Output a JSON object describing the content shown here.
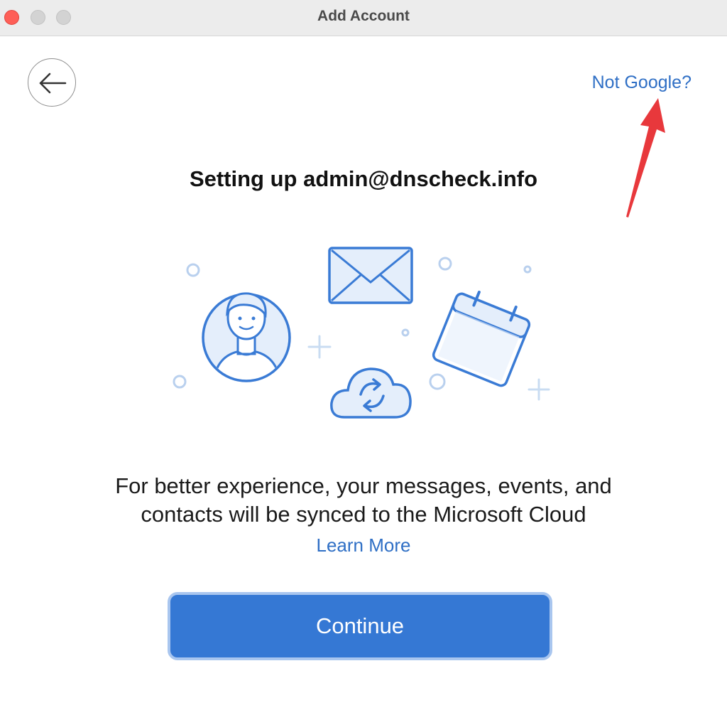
{
  "window": {
    "title": "Add Account",
    "controls": [
      "close",
      "minimize",
      "zoom"
    ]
  },
  "nav": {
    "back_icon": "arrow-left-icon",
    "not_google_link": "Not Google?"
  },
  "annotation": {
    "type": "arrow",
    "color": "#e8383c",
    "points_to": "Not Google?"
  },
  "heading": "Setting up admin@dnscheck.info",
  "illustration": {
    "icons": [
      "avatar-icon",
      "envelope-icon",
      "calendar-icon",
      "cloud-sync-icon"
    ],
    "accent_color": "#3a7bd5",
    "fill_color": "#e4eefb"
  },
  "message": {
    "line1": "For better experience, your messages, events, and",
    "line2": "contacts will be synced to the Microsoft Cloud"
  },
  "learn_more_link": "Learn More",
  "continue_button": "Continue",
  "colors": {
    "link": "#2f6fc5",
    "primary_button": "#3578d4",
    "button_focus_ring": "#a9c6ef"
  }
}
